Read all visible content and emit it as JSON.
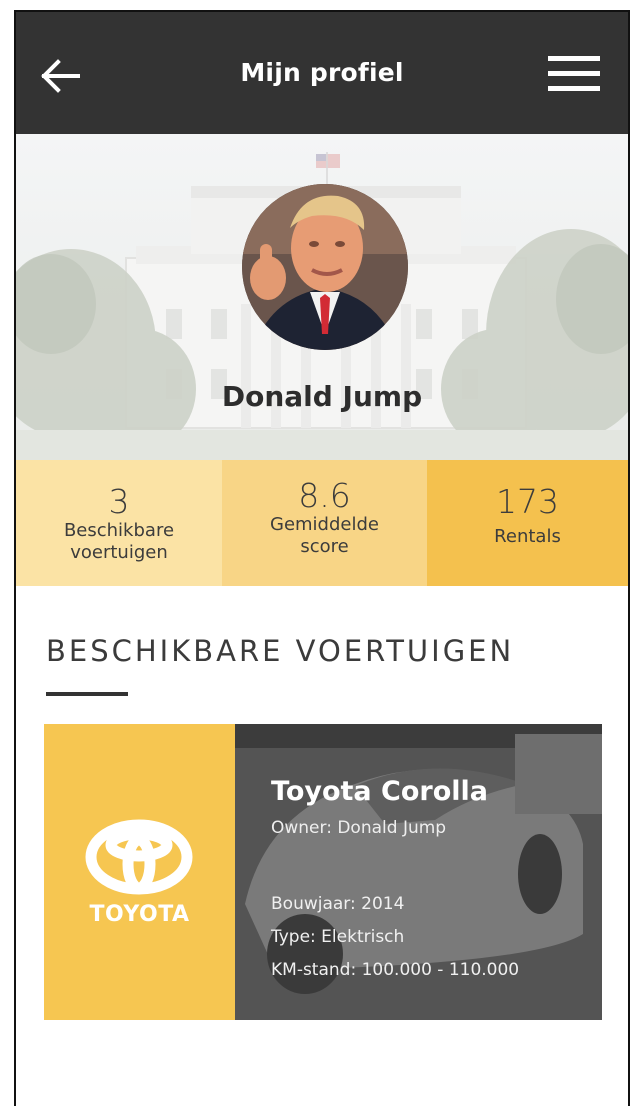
{
  "header": {
    "title": "Mijn profiel",
    "back_icon": "arrow-left-icon",
    "menu_icon": "hamburger-menu-icon",
    "background": "#333333"
  },
  "profile": {
    "name": "Donald Jump"
  },
  "stats": [
    {
      "value": "3",
      "label_line1": "Beschikbare",
      "label_line2": "voertuigen",
      "color": "#fbe3a5"
    },
    {
      "value": "8.6",
      "label_line1": "Gemiddelde",
      "label_line2": "score",
      "color": "#f8d586"
    },
    {
      "value": "173",
      "label_line1": "Rentals",
      "label_line2": "",
      "color": "#f4c14e"
    }
  ],
  "section": {
    "title": "BESCHIKBARE VOERTUIGEN"
  },
  "vehicle": {
    "brand": "TOYOTA",
    "name": "Toyota Corolla",
    "owner": "Owner: Donald Jump",
    "year": "Bouwjaar: 2014",
    "type": "Type: Elektrisch",
    "mileage": "KM-stand: 100.000 - 110.000",
    "accent": "#f6c651"
  }
}
